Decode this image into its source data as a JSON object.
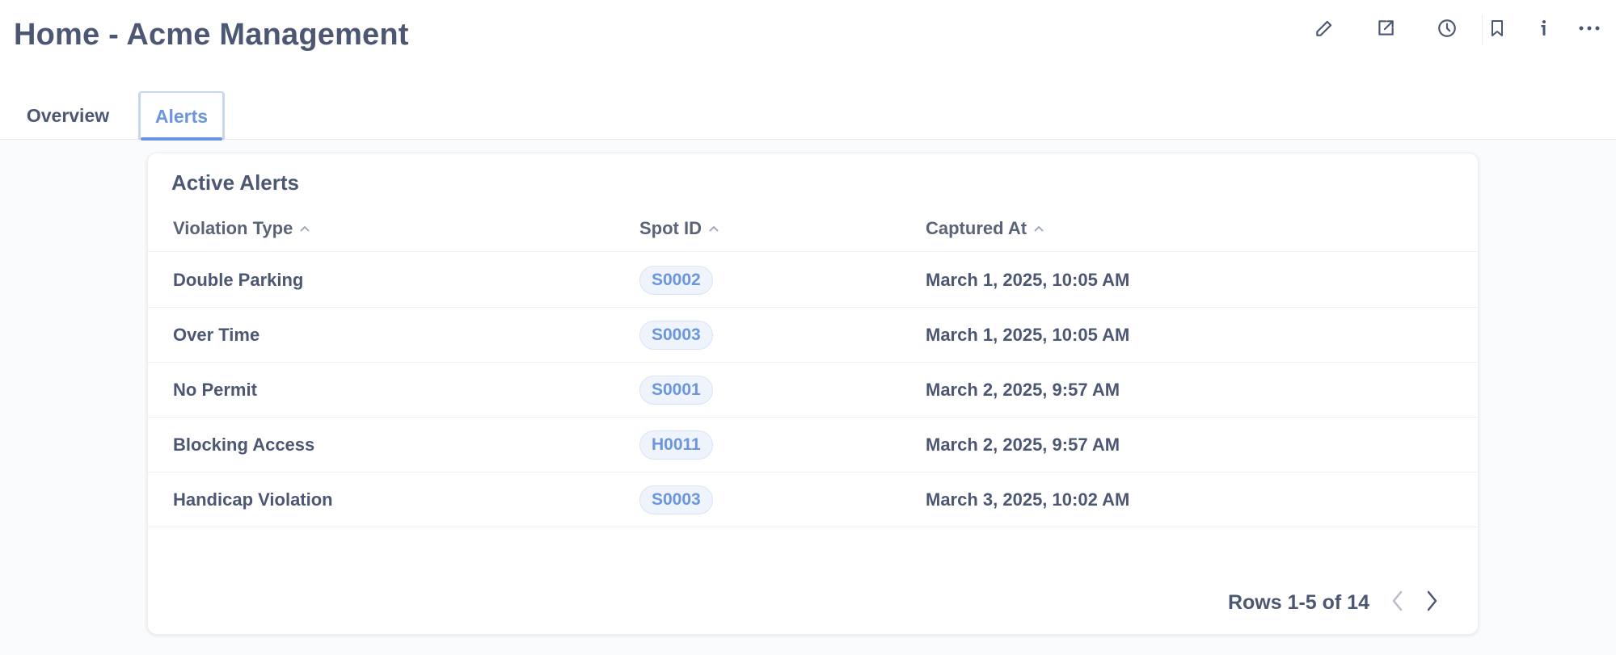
{
  "header": {
    "title": "Home - Acme Management",
    "toolbar": {
      "icons": [
        "pencil-icon",
        "share-icon",
        "clock-icon",
        "bookmark-icon",
        "info-icon",
        "more-icon"
      ]
    }
  },
  "tabs": [
    {
      "label": "Overview",
      "active": false
    },
    {
      "label": "Alerts",
      "active": true
    }
  ],
  "card": {
    "title": "Active Alerts",
    "columns": [
      "Violation Type",
      "Spot ID",
      "Captured At"
    ],
    "rows": [
      {
        "violation": "Double Parking",
        "spot": "S0002",
        "captured": "March 1, 2025, 10:05 AM"
      },
      {
        "violation": "Over Time",
        "spot": "S0003",
        "captured": "March 1, 2025, 10:05 AM"
      },
      {
        "violation": "No Permit",
        "spot": "S0001",
        "captured": "March 2, 2025, 9:57 AM"
      },
      {
        "violation": "Blocking Access",
        "spot": "H0011",
        "captured": "March 2, 2025, 9:57 AM"
      },
      {
        "violation": "Handicap Violation",
        "spot": "S0003",
        "captured": "March 3, 2025, 10:02 AM"
      }
    ],
    "pagination": "Rows 1-5 of 14"
  },
  "colors": {
    "text": "#4c5773",
    "accent": "#6b96de",
    "pill_bg": "#eef3fc",
    "background": "#f9fbfc"
  }
}
